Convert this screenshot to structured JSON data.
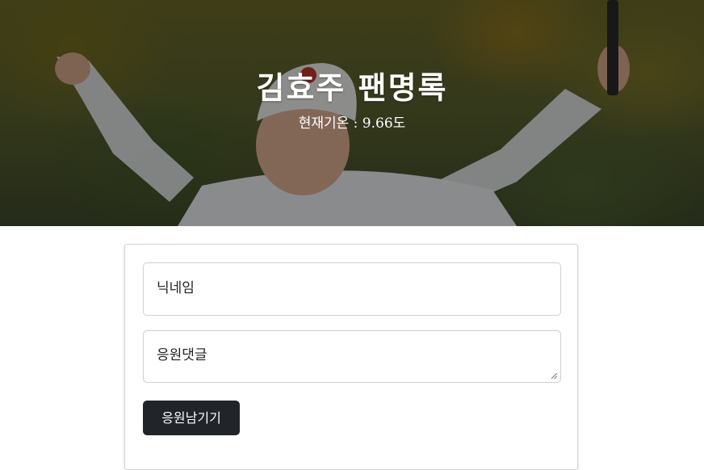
{
  "hero": {
    "title": "김효주 팬명록",
    "weather": "현재기온 : 9.66도"
  },
  "form": {
    "nickname_placeholder": "닉네임",
    "comment_placeholder": "응원댓글",
    "submit_label": "응원남기기"
  },
  "colors": {
    "button_bg": "#212529",
    "overlay": "rgba(0,0,0,0.42)"
  }
}
